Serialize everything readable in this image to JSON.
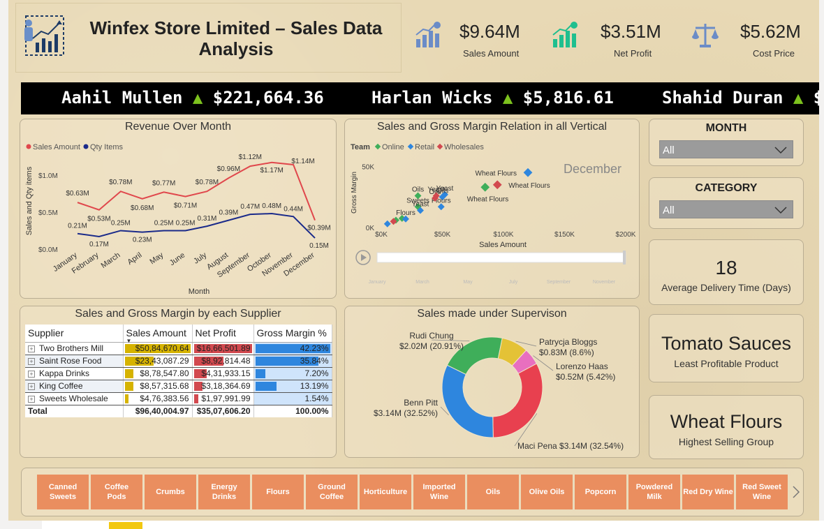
{
  "header": {
    "title": "Winfex Store Limited – Sales Data Analysis"
  },
  "kpis": [
    {
      "value": "$9.64M",
      "label": "Sales Amount",
      "icon": "chart-up-icon",
      "color": "#6b8cc7"
    },
    {
      "value": "$3.51M",
      "label": "Net Profit",
      "icon": "chart-up-icon",
      "color": "#1fbf8f"
    },
    {
      "value": "$5.62M",
      "label": "Cost Price",
      "icon": "scale-icon",
      "color": "#6b8cc7"
    }
  ],
  "ticker": [
    {
      "name": "Aahil Mullen",
      "amount": "$221,664.36"
    },
    {
      "name": "Harlan Wicks",
      "amount": "$5,816.61"
    },
    {
      "name": "Shahid Duran",
      "amount": "$"
    }
  ],
  "revenue_panel": {
    "title": "Revenue Over Month",
    "legend": [
      "Sales Amount",
      "Qty Items"
    ],
    "xlabel": "Month",
    "ylabel": "Sales and Qty items"
  },
  "scatter_panel": {
    "title": "Sales and Gross Margin Relation in all Vertical",
    "legend_title": "Team",
    "legend": [
      "Online",
      "Retail",
      "Wholesales"
    ],
    "frame_label": "December",
    "xlabel": "Sales Amount",
    "ylabel": "Gross Margin",
    "play_ticks": [
      "January",
      "March",
      "May",
      "July",
      "September",
      "November"
    ]
  },
  "supplier_panel": {
    "title": "Sales and Gross Margin by each Supplier",
    "columns": [
      "Supplier",
      "Sales Amount",
      "Net Profit",
      "Gross Margin %"
    ],
    "rows": [
      {
        "supplier": "Two Brothers Mill",
        "sales": "$50,84,670.64",
        "profit": "$16,66,501.89",
        "margin": "42.23%",
        "sales_frac": 1.0,
        "profit_frac": 1.0,
        "margin_frac": 1.0
      },
      {
        "supplier": "Saint Rose Food",
        "sales": "$23,43,087.29",
        "profit": "$8,92,814.48",
        "margin": "35.84%",
        "sales_frac": 0.461,
        "profit_frac": 0.536,
        "margin_frac": 0.849
      },
      {
        "supplier": "Kappa Drinks",
        "sales": "$8,78,547.80",
        "profit": "$4,31,933.15",
        "margin": "7.20%",
        "sales_frac": 0.173,
        "profit_frac": 0.259,
        "margin_frac": 0.17
      },
      {
        "supplier": "King Coffee",
        "sales": "$8,57,315.68",
        "profit": "$3,18,364.69",
        "margin": "13.19%",
        "sales_frac": 0.169,
        "profit_frac": 0.191,
        "margin_frac": 0.312
      },
      {
        "supplier": "Sweets Wholesale",
        "sales": "$4,76,383.56",
        "profit": "$1,97,991.99",
        "margin": "1.54%",
        "sales_frac": 0.094,
        "profit_frac": 0.119,
        "margin_frac": 0.036
      }
    ],
    "total": {
      "label": "Total",
      "sales": "$96,40,004.97",
      "profit": "$35,07,606.20",
      "margin": "100.00%"
    },
    "colors": {
      "sales_bar": "#d6b300",
      "profit_bar": "#d2494f",
      "margin_bar": "#2e86de"
    }
  },
  "donut_panel": {
    "title": "Sales made under Supervison"
  },
  "slicers": [
    {
      "title": "MONTH",
      "value": "All"
    },
    {
      "title": "CATEGORY",
      "value": "All"
    }
  ],
  "cards": [
    {
      "value": "18",
      "label": "Average Delivery Time (Days)"
    },
    {
      "value": "Tomato Sauces",
      "label": "Least Profitable Product"
    },
    {
      "value": "Wheat Flours",
      "label": "Highest Selling Group"
    }
  ],
  "categories": [
    "Canned Sweets",
    "Coffee Pods",
    "Crumbs",
    "Energy Drinks",
    "Flours",
    "Ground Coffee",
    "Horticulture",
    "Imported Wine",
    "Oils",
    "Olive Oils",
    "Popcorn",
    "Powdered Milk",
    "Red Dry Wine",
    "Red Sweet Wine"
  ],
  "chart_data": [
    {
      "type": "line",
      "title": "Revenue Over Month",
      "categories": [
        "January",
        "February",
        "March",
        "April",
        "May",
        "June",
        "July",
        "August",
        "September",
        "October",
        "November",
        "December"
      ],
      "series": [
        {
          "name": "Sales Amount",
          "color": "#e0474c",
          "values": [
            0.63,
            0.53,
            0.78,
            0.68,
            0.77,
            0.71,
            0.78,
            0.96,
            1.12,
            1.17,
            1.14,
            0.39
          ],
          "labels": [
            "$0.63M",
            "$0.53M",
            "$0.78M",
            "$0.68M",
            "$0.77M",
            "$0.71M",
            "$0.78M",
            "$0.96M",
            "$1.12M",
            "$1.17M",
            "$1.14M",
            "$0.39M"
          ]
        },
        {
          "name": "Qty Items",
          "color": "#1a2a8a",
          "values": [
            0.21,
            0.17,
            0.25,
            0.23,
            0.25,
            0.25,
            0.31,
            0.39,
            0.47,
            0.48,
            0.44,
            0.15
          ],
          "labels": [
            "0.21M",
            "0.17M",
            "0.25M",
            "0.23M",
            "0.25M",
            "0.25M",
            "0.31M",
            "0.39M",
            "0.47M",
            "0.48M",
            "0.44M",
            "0.15M"
          ]
        }
      ],
      "yticks": [
        "$0.0M",
        "$0.5M",
        "$1.0M"
      ],
      "ylim": [
        0,
        1.3
      ],
      "xlabel": "Month",
      "ylabel": "Sales and Qty items",
      "legend": "top-left"
    },
    {
      "type": "scatter",
      "title": "Sales and Gross Margin Relation in all Vertical",
      "xlabel": "Sales Amount",
      "ylabel": "Gross Margin",
      "xticks": [
        "$0K",
        "$50K",
        "$100K",
        "$150K",
        "$200K"
      ],
      "yticks": [
        "0K",
        "50K"
      ],
      "xlim": [
        0,
        200000
      ],
      "ylim": [
        0,
        60000
      ],
      "series": [
        {
          "name": "Online",
          "color": "#3fae5a",
          "points": [
            {
              "x": 85000,
              "y": 33000,
              "label": "Wheat Flours"
            },
            {
              "x": 30000,
              "y": 26000,
              "label": "Oils"
            },
            {
              "x": 30000,
              "y": 17000,
              "label": "Sweets"
            },
            {
              "x": 12000,
              "y": 6000,
              "label": ""
            },
            {
              "x": 17000,
              "y": 7500,
              "label": ""
            }
          ]
        },
        {
          "name": "Retail",
          "color": "#2e86de",
          "points": [
            {
              "x": 120000,
              "y": 45000,
              "label": "Wheat Flours"
            },
            {
              "x": 52000,
              "y": 27000,
              "label": "Yeast"
            },
            {
              "x": 50000,
              "y": 25000,
              "label": "Oils"
            },
            {
              "x": 49000,
              "y": 17000,
              "label": "Flours"
            },
            {
              "x": 32000,
              "y": 14000,
              "label": "Yeast"
            },
            {
              "x": 20000,
              "y": 7000,
              "label": "Flours"
            },
            {
              "x": 5000,
              "y": 3000,
              "label": ""
            }
          ]
        },
        {
          "name": "Wholesales",
          "color": "#d2494f",
          "points": [
            {
              "x": 95000,
              "y": 35000,
              "label": "Wheat Flours"
            },
            {
              "x": 44000,
              "y": 24000,
              "label": "Oils"
            },
            {
              "x": 45000,
              "y": 26000,
              "label": "Yeast"
            },
            {
              "x": 10000,
              "y": 5000,
              "label": ""
            }
          ]
        }
      ],
      "legend": "top-left"
    },
    {
      "type": "pie",
      "title": "Sales made under Supervison",
      "donut": true,
      "slices": [
        {
          "name": "Maci Pena",
          "value": 3.14,
          "label": "Maci Pena $3.14M (32.54%)",
          "color": "#e8404f"
        },
        {
          "name": "Benn Pitt",
          "value": 3.14,
          "label": "Benn Pitt\n$3.14M (32.52%)",
          "color": "#2e86de"
        },
        {
          "name": "Rudi Chung",
          "value": 2.02,
          "label": "Rudi Chung\n$2.02M (20.91%)",
          "color": "#3fae5a"
        },
        {
          "name": "Patrycja Bloggs",
          "value": 0.83,
          "label": "Patrycja Bloggs\n$0.83M (8.6%)",
          "color": "#e4c236"
        },
        {
          "name": "Lorenzo Haas",
          "value": 0.52,
          "label": "Lorenzo Haas\n$0.52M (5.42%)",
          "color": "#e86fbf"
        }
      ]
    }
  ]
}
